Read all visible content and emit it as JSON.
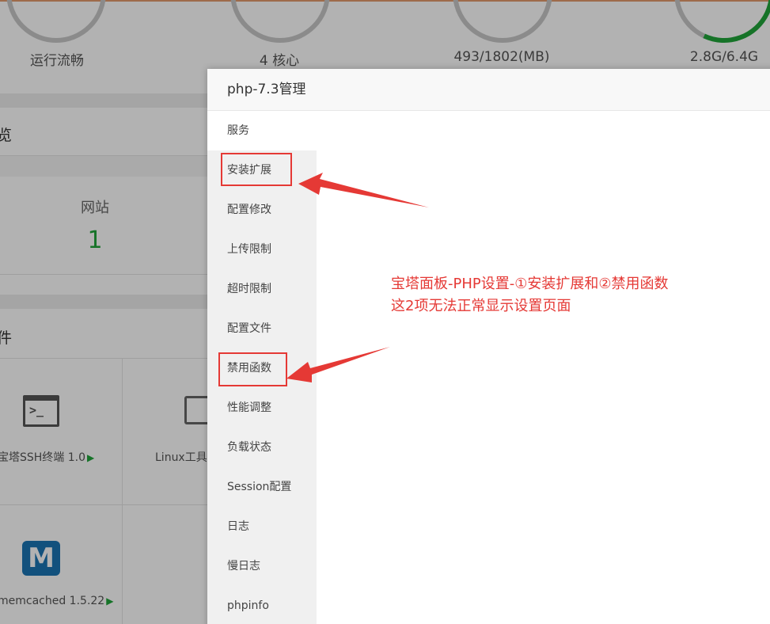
{
  "dashboard": {
    "gauges": [
      {
        "label": "运行流畅"
      },
      {
        "label": "4 核心"
      },
      {
        "label": "493/1802(MB)"
      },
      {
        "label": "2.8G/6.4G"
      }
    ],
    "overview_title_fragment": "览",
    "site_label": "网站",
    "site_count": "1",
    "software_title_fragment": "件",
    "software": [
      {
        "name": "宝塔SSH终端 1.0",
        "icon": "terminal-icon"
      },
      {
        "name": "Linux工具",
        "icon": "toolbox-icon"
      },
      {
        "name": "memcached 1.5.22",
        "icon": "memcached-icon"
      }
    ],
    "play_glyph": "▶",
    "memcached_glyph": "M",
    "terminal_glyph": ">_"
  },
  "modal": {
    "title": "php-7.3管理",
    "menu": [
      "服务",
      "安装扩展",
      "配置修改",
      "上传限制",
      "超时限制",
      "配置文件",
      "禁用函数",
      "性能调整",
      "负载状态",
      "Session配置",
      "日志",
      "慢日志",
      "phpinfo"
    ],
    "active_index": 0
  },
  "annotation": {
    "line1": "宝塔面板-PHP设置-①安装扩展和②禁用函数",
    "line2": "这2项无法正常显示设置页面",
    "color": "#e53935"
  },
  "colors": {
    "accent_green": "#20a53a",
    "annotation_red": "#e53935"
  }
}
